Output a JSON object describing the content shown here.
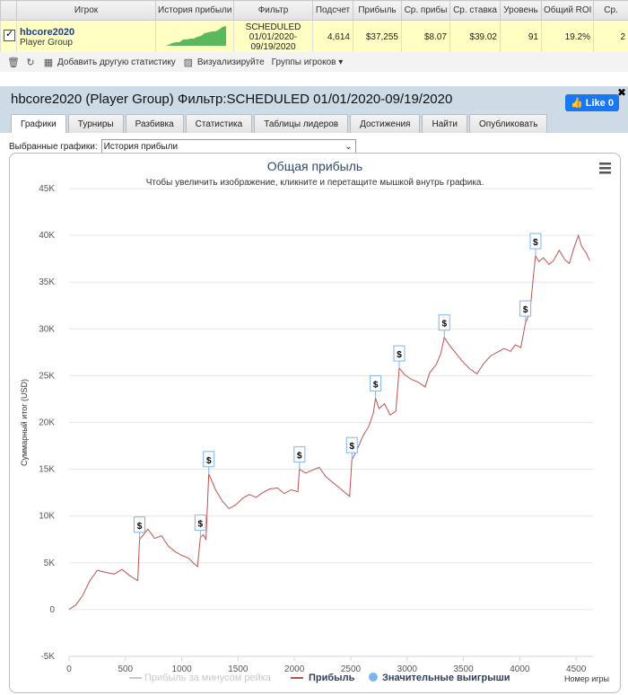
{
  "table": {
    "headers": [
      "",
      "Игрок",
      "История прибыли",
      "Фильтр",
      "Подсчет",
      "Прибыль",
      "Ср. прибы",
      "Ср. ставка",
      "Уровень",
      "Общий ROI",
      "Ср."
    ],
    "row": {
      "player": "hbcore2020",
      "player_type": "Player Group",
      "filter_line1": "SCHEDULED",
      "filter_line2": "01/01/2020-",
      "filter_line3": "09/19/2020",
      "count": "4,614",
      "profit": "$37,255",
      "avg_profit": "$8.07",
      "avg_stake": "$39.02",
      "level": "91",
      "roi": "19.2%",
      "last": "2"
    }
  },
  "toolbar": {
    "add_stats": "Добавить другую статистику",
    "visualize": "Визуализируйте",
    "player_groups": "Группы игроков ▾"
  },
  "panel": {
    "title": "hbcore2020 (Player Group) Фильтр:SCHEDULED 01/01/2020-09/19/2020",
    "like_label": "Like 0",
    "tabs": [
      "Графики",
      "Турниры",
      "Разбивка",
      "Статистика",
      "Таблицы лидеров",
      "Достижения",
      "Найти",
      "Опубликовать"
    ],
    "select_label": "Выбранные графики:",
    "select_value": "История прибыли"
  },
  "chart_data": {
    "type": "line",
    "title": "Общая прибыль",
    "subtitle": "Чтобы увеличить изображение, кликните и перетащите мышкой внутрь графика.",
    "ylabel": "Суммарный итог (USD)",
    "xlabel": "Номер игры",
    "ylim": [
      -5000,
      45000
    ],
    "xlim": [
      0,
      4650
    ],
    "y_ticks": [
      "-5K",
      "0",
      "5K",
      "10K",
      "15K",
      "20K",
      "25K",
      "30K",
      "35K",
      "40K",
      "45K"
    ],
    "x_ticks": [
      "0",
      "500",
      "1000",
      "1500",
      "2000",
      "2500",
      "3000",
      "3500",
      "4000",
      "4500"
    ],
    "legend": [
      "Прибыль за минусом рейка",
      "Прибыль",
      "Значительные выигрыши"
    ],
    "series": [
      {
        "name": "Прибыль",
        "color": "#c0504d",
        "points": [
          [
            0,
            0
          ],
          [
            60,
            500
          ],
          [
            120,
            1500
          ],
          [
            180,
            3000
          ],
          [
            250,
            4200
          ],
          [
            320,
            4000
          ],
          [
            400,
            3800
          ],
          [
            470,
            4300
          ],
          [
            530,
            3700
          ],
          [
            580,
            3300
          ],
          [
            610,
            3100
          ],
          [
            625,
            7500
          ],
          [
            660,
            8000
          ],
          [
            700,
            8600
          ],
          [
            760,
            7600
          ],
          [
            820,
            7900
          ],
          [
            880,
            6800
          ],
          [
            940,
            6200
          ],
          [
            1000,
            5800
          ],
          [
            1060,
            5500
          ],
          [
            1110,
            4900
          ],
          [
            1140,
            4600
          ],
          [
            1165,
            7700
          ],
          [
            1190,
            8000
          ],
          [
            1215,
            7500
          ],
          [
            1240,
            14500
          ],
          [
            1300,
            12800
          ],
          [
            1360,
            11600
          ],
          [
            1420,
            10800
          ],
          [
            1480,
            11200
          ],
          [
            1540,
            11900
          ],
          [
            1600,
            12300
          ],
          [
            1660,
            12000
          ],
          [
            1720,
            12500
          ],
          [
            1780,
            12900
          ],
          [
            1850,
            13000
          ],
          [
            1910,
            12400
          ],
          [
            1970,
            12800
          ],
          [
            2030,
            12600
          ],
          [
            2045,
            15000
          ],
          [
            2100,
            14600
          ],
          [
            2160,
            14900
          ],
          [
            2220,
            15200
          ],
          [
            2280,
            14200
          ],
          [
            2340,
            13600
          ],
          [
            2400,
            13000
          ],
          [
            2460,
            12400
          ],
          [
            2490,
            12100
          ],
          [
            2510,
            16000
          ],
          [
            2560,
            17200
          ],
          [
            2610,
            18600
          ],
          [
            2660,
            19600
          ],
          [
            2700,
            21000
          ],
          [
            2720,
            22600
          ],
          [
            2750,
            21500
          ],
          [
            2800,
            22000
          ],
          [
            2850,
            20800
          ],
          [
            2900,
            21200
          ],
          [
            2930,
            25800
          ],
          [
            2980,
            25100
          ],
          [
            3040,
            24600
          ],
          [
            3100,
            24300
          ],
          [
            3160,
            23800
          ],
          [
            3200,
            25300
          ],
          [
            3260,
            26200
          ],
          [
            3300,
            27400
          ],
          [
            3330,
            29100
          ],
          [
            3380,
            28200
          ],
          [
            3440,
            27300
          ],
          [
            3500,
            26400
          ],
          [
            3560,
            25700
          ],
          [
            3620,
            25200
          ],
          [
            3680,
            26300
          ],
          [
            3740,
            27100
          ],
          [
            3800,
            27500
          ],
          [
            3860,
            27900
          ],
          [
            3920,
            27600
          ],
          [
            3960,
            28300
          ],
          [
            4010,
            28000
          ],
          [
            4050,
            30600
          ],
          [
            4090,
            31800
          ],
          [
            4120,
            35500
          ],
          [
            4140,
            37800
          ],
          [
            4170,
            37200
          ],
          [
            4210,
            37600
          ],
          [
            4260,
            36900
          ],
          [
            4300,
            37300
          ],
          [
            4350,
            38400
          ],
          [
            4400,
            37400
          ],
          [
            4440,
            37000
          ],
          [
            4480,
            38600
          ],
          [
            4520,
            40000
          ],
          [
            4550,
            38800
          ],
          [
            4590,
            38100
          ],
          [
            4620,
            37300
          ]
        ]
      }
    ],
    "big_wins": [
      [
        625,
        7500
      ],
      [
        1165,
        7700
      ],
      [
        1240,
        14500
      ],
      [
        2045,
        15000
      ],
      [
        2510,
        16000
      ],
      [
        2720,
        22600
      ],
      [
        2930,
        25800
      ],
      [
        3330,
        29100
      ],
      [
        4050,
        30600
      ],
      [
        4140,
        37800
      ]
    ]
  }
}
